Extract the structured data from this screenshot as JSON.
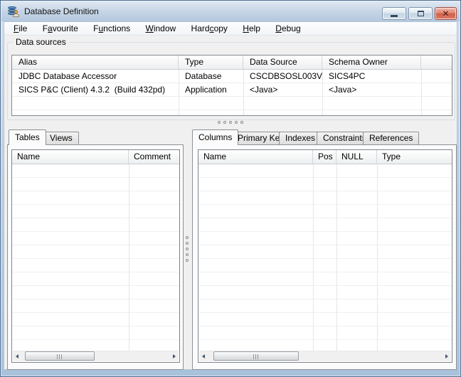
{
  "window": {
    "title": "Database Definition",
    "controls": {
      "minimize": "minimize",
      "maximize": "maximize",
      "close": "close"
    },
    "icon": "database-user-icon"
  },
  "menu": {
    "items": [
      {
        "pre": "",
        "key": "F",
        "post": "ile"
      },
      {
        "pre": "F",
        "key": "a",
        "post": "vourite"
      },
      {
        "pre": "F",
        "key": "u",
        "post": "nctions"
      },
      {
        "pre": "",
        "key": "W",
        "post": "indow"
      },
      {
        "pre": "Hard",
        "key": "c",
        "post": "opy"
      },
      {
        "pre": "",
        "key": "H",
        "post": "elp"
      },
      {
        "pre": "",
        "key": "D",
        "post": "ebug"
      }
    ]
  },
  "data_sources": {
    "label": "Data sources",
    "columns": [
      "Alias",
      "Type",
      "Data Source",
      "Schema Owner"
    ],
    "rows": [
      {
        "alias": "JDBC Database Accessor",
        "type": "Database",
        "source": "CSCDBSOSL003V",
        "owner": "SICS4PC"
      },
      {
        "alias": "SICS P&C (Client) 4.3.2  (Build 432pd)",
        "type": "Application",
        "source": "<Java>",
        "owner": "<Java>"
      }
    ]
  },
  "tables_panel": {
    "tabs": [
      "Tables",
      "Views"
    ],
    "active_tab": "Tables",
    "columns": [
      "Name",
      "Comment"
    ]
  },
  "details_panel": {
    "tabs": [
      "Columns",
      "Primary Key",
      "Indexes",
      "Constraints",
      "References"
    ],
    "active_tab": "Columns",
    "columns": [
      "Name",
      "Pos",
      "NULL",
      "Type"
    ]
  },
  "colors": {
    "titlebar_top": "#dfe8f2",
    "titlebar_bottom": "#b4c8de",
    "frame": "#a8c2dc",
    "client_bg": "#f0f0f0",
    "close_button": "#cf6049",
    "header_gradient_bottom": "#edeff1",
    "grid_line": "#e3e5e7"
  }
}
